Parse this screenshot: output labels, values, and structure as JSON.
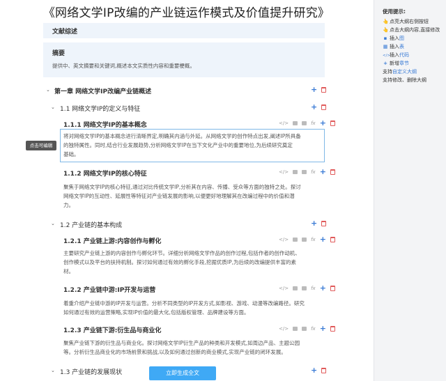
{
  "title": "《网络文学IP改编的产业链运作模式及价值提升研究》",
  "literature_review": "文献综述",
  "abstract": {
    "heading": "摘要",
    "text": "提供中、英文摘要和关键词,概述本文实质性内容和重要梗概。"
  },
  "chapter1": {
    "label": "第一章 网络文学IP改编产业链概述"
  },
  "s1_1": {
    "label": "1.1 网络文学IP的定义与特征"
  },
  "s1_1_1": {
    "label": "1.1.1 网络文学IP的基本概念",
    "text": [
      "将对网络文学IP的基本概念进行清晰界定,明确其内涵与外延。从网络文学的创作特点出发,阐述IP所具备",
      "的独特属性。同时,结合行业发展趋势,分析网络文学IP在当下文化产业中的重要地位,为后续研究奠定",
      "基础。"
    ]
  },
  "tooltip": "点击可编辑",
  "s1_1_2": {
    "label": "1.1.2 网络文学IP的核心特征",
    "text": [
      "聚焦于网络文学IP的核心特征,通过对比传统文学IP,分析其在内容、传播、受众等方面的独特之处。探讨",
      "网络文学IP的互动性、延展性等特征对产业链发展的影响,以便更好地理解其在改编过程中的价值和潜",
      "力。"
    ]
  },
  "s1_2": {
    "label": "1.2 产业链的基本构成"
  },
  "s1_2_1": {
    "label": "1.2.1 产业链上游:内容创作与孵化",
    "text": [
      "主要研究产业链上游的内容创作与孵化环节。详细分析网络文学作品的创作过程,包括作者的创作动机、",
      "创作模式以及平台的扶持机制。探讨如何通过有效的孵化手段,挖掘优质IP,为后续的改编提供丰富的素",
      "材。"
    ]
  },
  "s1_2_2": {
    "label": "1.2.2 产业链中游:IP开发与运营",
    "text": [
      "着重介绍产业链中游的IP开发与运营。分析不同类型的IP开发方式,如影视、游戏、动漫等改编路径。研究",
      "如何通过有效的运营策略,实现IP价值的最大化,包括版权管理、品牌建设等方面。"
    ]
  },
  "s1_2_3": {
    "label": "1.2.3 产业链下游:衍生品与商业化",
    "text": [
      "聚焦产业链下游的衍生品与商业化。探讨网络文学IP衍生产品的种类和开发模式,如周边产品、主题公园",
      "等。分析衍生品商业化的市场前景和挑战,以及如何通过创新的商业模式,实现产业链的闭环发展。"
    ]
  },
  "s1_3": {
    "label": "1.3 产业链的发展现状"
  },
  "generate_button": "立即生成全文",
  "ops": {
    "fx": "fx",
    "code": "</>"
  },
  "tips": {
    "title": "使用提示:",
    "items": [
      {
        "icon": "hand-icon",
        "glyph": "👆",
        "pre": "点亮大纲右侧按钮",
        "hl": "",
        "post": ""
      },
      {
        "icon": "hand-icon",
        "glyph": "👆",
        "pre": "点击大纲内容,直接修改",
        "hl": "",
        "post": ""
      },
      {
        "icon": "image-icon",
        "glyph": "▪",
        "pre": "插入",
        "hl": "图",
        "post": ""
      },
      {
        "icon": "table-icon",
        "glyph": "▦",
        "pre": "插入",
        "hl": "表",
        "post": ""
      },
      {
        "icon": "code-icon",
        "glyph": "</>",
        "pre": "插入",
        "hl": "代码",
        "post": ""
      },
      {
        "icon": "plus-icon",
        "glyph": "+",
        "pre": "新增",
        "hl": "章节",
        "post": ""
      },
      {
        "icon": "",
        "glyph": "",
        "pre": "支持",
        "hl": "自定义大纲",
        "post": ""
      },
      {
        "icon": "",
        "glyph": "",
        "pre": "支持修改、删除大纲",
        "hl": "",
        "post": ""
      }
    ]
  }
}
